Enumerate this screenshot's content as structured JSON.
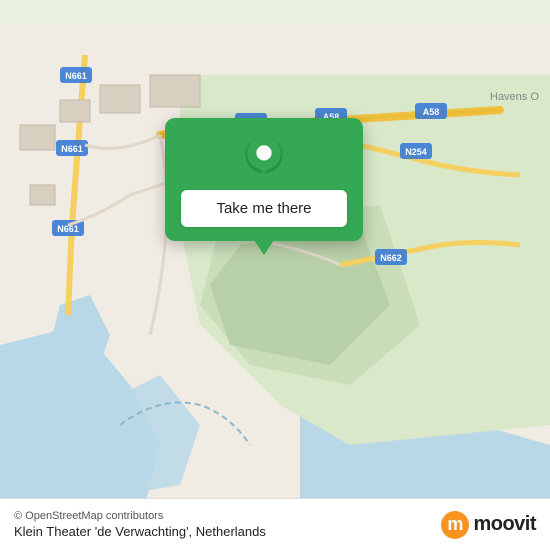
{
  "map": {
    "background_color": "#e8f0e0",
    "alt": "Map of Netherlands near Klein Theater de Verwachting"
  },
  "popup": {
    "button_label": "Take me there",
    "pin_color": "#ffffff"
  },
  "bottom_bar": {
    "attribution": "© OpenStreetMap contributors",
    "location_name": "Klein Theater 'de Verwachting', Netherlands",
    "moovit_label": "moovit"
  }
}
